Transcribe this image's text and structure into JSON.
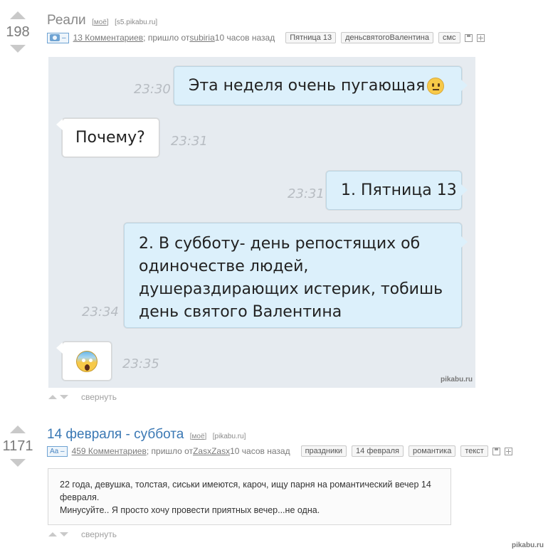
{
  "post1": {
    "rating": "198",
    "title": "Реали",
    "mine_link": "моё",
    "domain": "[s5.pikabu.ru]",
    "type_badge": "–",
    "comments": "13 Комментариев",
    "from_prefix": "; пришло от ",
    "author": "subiria",
    "time": " 10 часов назад",
    "tags": [
      "Пятница 13",
      "деньсвятогоВалентина",
      "смс"
    ],
    "chat": {
      "messages": [
        {
          "text": "Эта неделя очень пугающая",
          "time": "23:30",
          "side": "out",
          "emoji": "neutral-face"
        },
        {
          "text": "Почему?",
          "time": "23:31",
          "side": "in"
        },
        {
          "text": "1. Пятница 13",
          "time": "23:31",
          "side": "out"
        },
        {
          "text": "2. В субботу- день репостящих об одиночестве людей, душераздирающих истерик, тобишь день святого Валентина",
          "time": "23:34",
          "side": "out"
        },
        {
          "text": "",
          "time": "23:35",
          "side": "in",
          "emoji": "screaming-face"
        }
      ],
      "watermark": "pikabu.ru"
    },
    "collapse": "свернуть"
  },
  "post2": {
    "rating": "1171",
    "title": "14 февраля - суббота",
    "mine_link": "моё",
    "domain": "[pikabu.ru]",
    "type_badge": "Aa –",
    "comments": "459 Комментариев",
    "from_prefix": "; пришло от ",
    "author": "ZasxZasx",
    "time": " 10 часов назад",
    "tags": [
      "праздники",
      "14 февраля",
      "романтика",
      "текст"
    ],
    "text_line1": "22 года, девушка, толстая, сиськи имеются, кароч, ищу парня на романтический вечер 14 февраля.",
    "text_line2": "Минусуйте.. Я просто хочу провести приятных вечер...не одна.",
    "collapse": "свернуть"
  },
  "footer_watermark": "pikabu.ru",
  "colors": {
    "title_blue": "#3a78b4",
    "bubble_out": "#dcf0fb",
    "chat_bg": "#e6ebf0"
  }
}
